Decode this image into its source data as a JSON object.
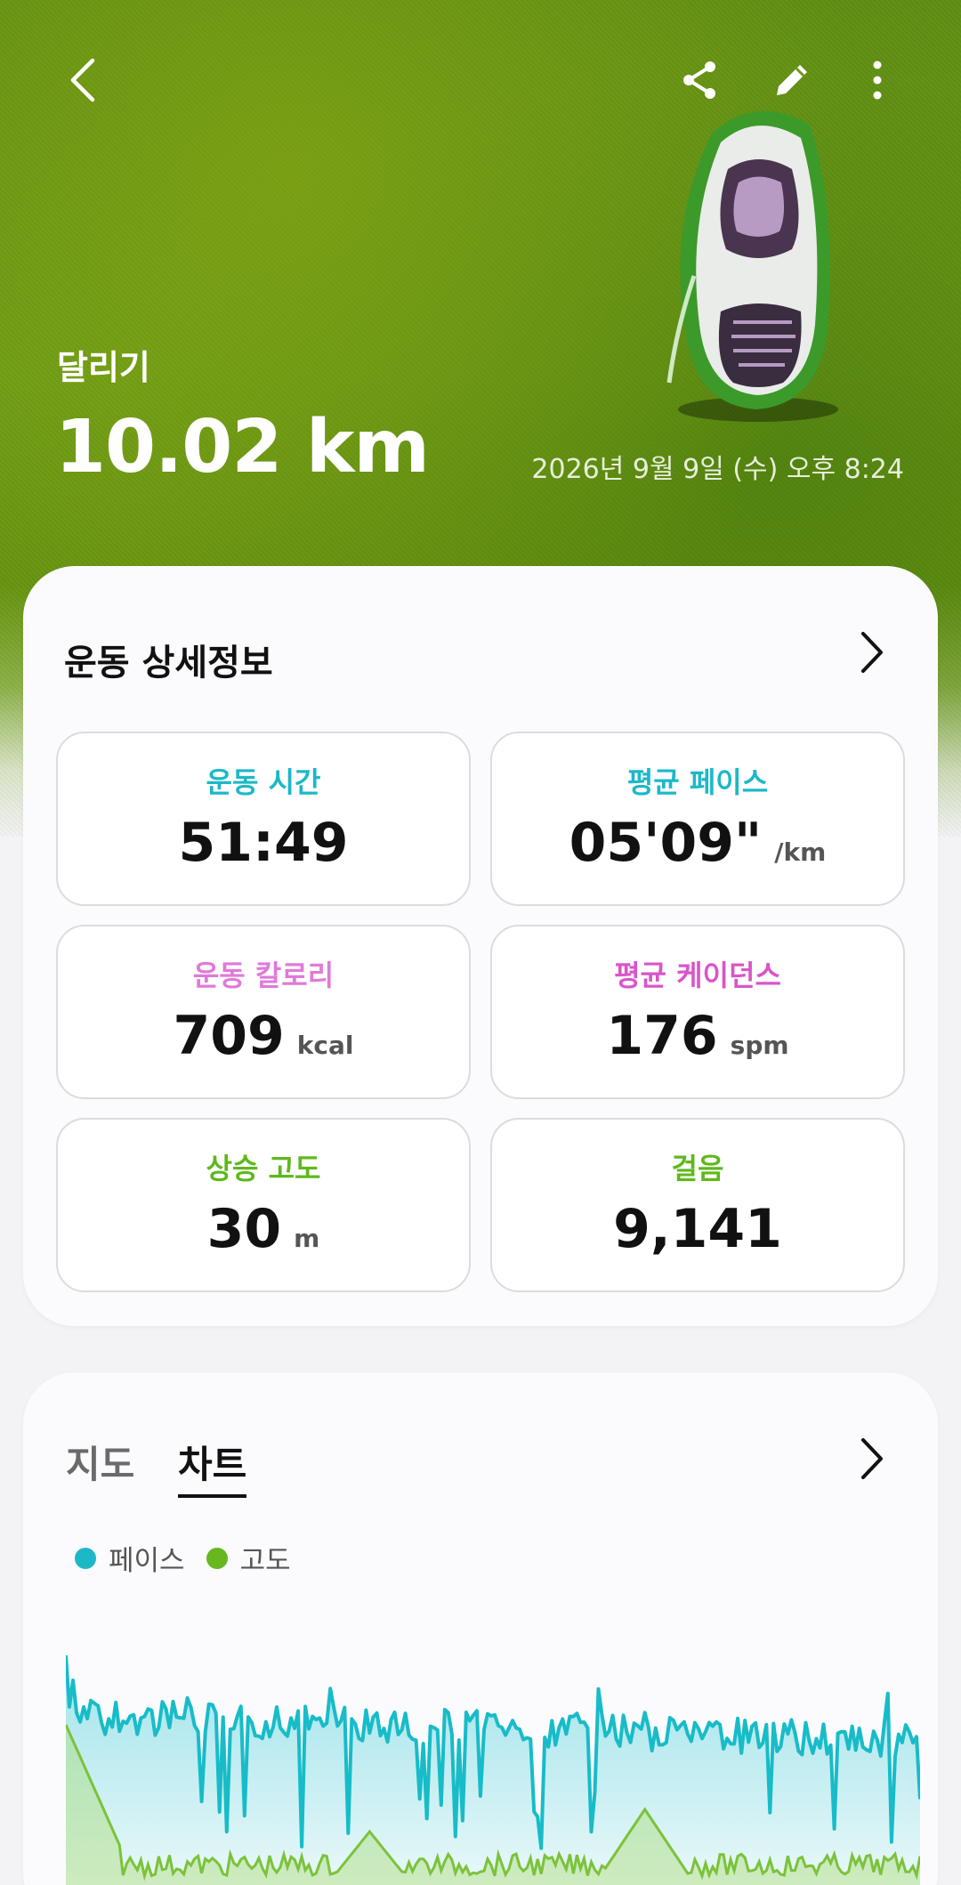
{
  "header": {
    "back_icon": "chevron-left-icon",
    "share_icon": "share-icon",
    "edit_icon": "pencil-icon",
    "more_icon": "more-vertical-icon"
  },
  "summary": {
    "activity_type": "달리기",
    "distance": "10.02 km",
    "datetime": "2026년 9월 9일 (수) 오후 8:24"
  },
  "details": {
    "title": "운동 상세정보",
    "stats": [
      {
        "label": "운동 시간",
        "value": "51:49",
        "unit": "",
        "color": "#1cb8c8"
      },
      {
        "label": "평균 페이스",
        "value": "05'09\"",
        "unit": "/km",
        "color": "#1cb8c8"
      },
      {
        "label": "운동 칼로리",
        "value": "709",
        "unit": "kcal",
        "color": "#e07ad8"
      },
      {
        "label": "평균 케이던스",
        "value": "176",
        "unit": "spm",
        "color": "#d955c9"
      },
      {
        "label": "상승 고도",
        "value": "30",
        "unit": "m",
        "color": "#5fb81c"
      },
      {
        "label": "걸음",
        "value": "9,141",
        "unit": "",
        "color": "#5fb81c"
      }
    ]
  },
  "charts": {
    "tabs": [
      "지도",
      "차트"
    ],
    "active_tab": "차트",
    "legend": [
      {
        "name": "페이스",
        "color": "#1cb8c8"
      },
      {
        "name": "고도",
        "color": "#66b81e"
      }
    ]
  }
}
